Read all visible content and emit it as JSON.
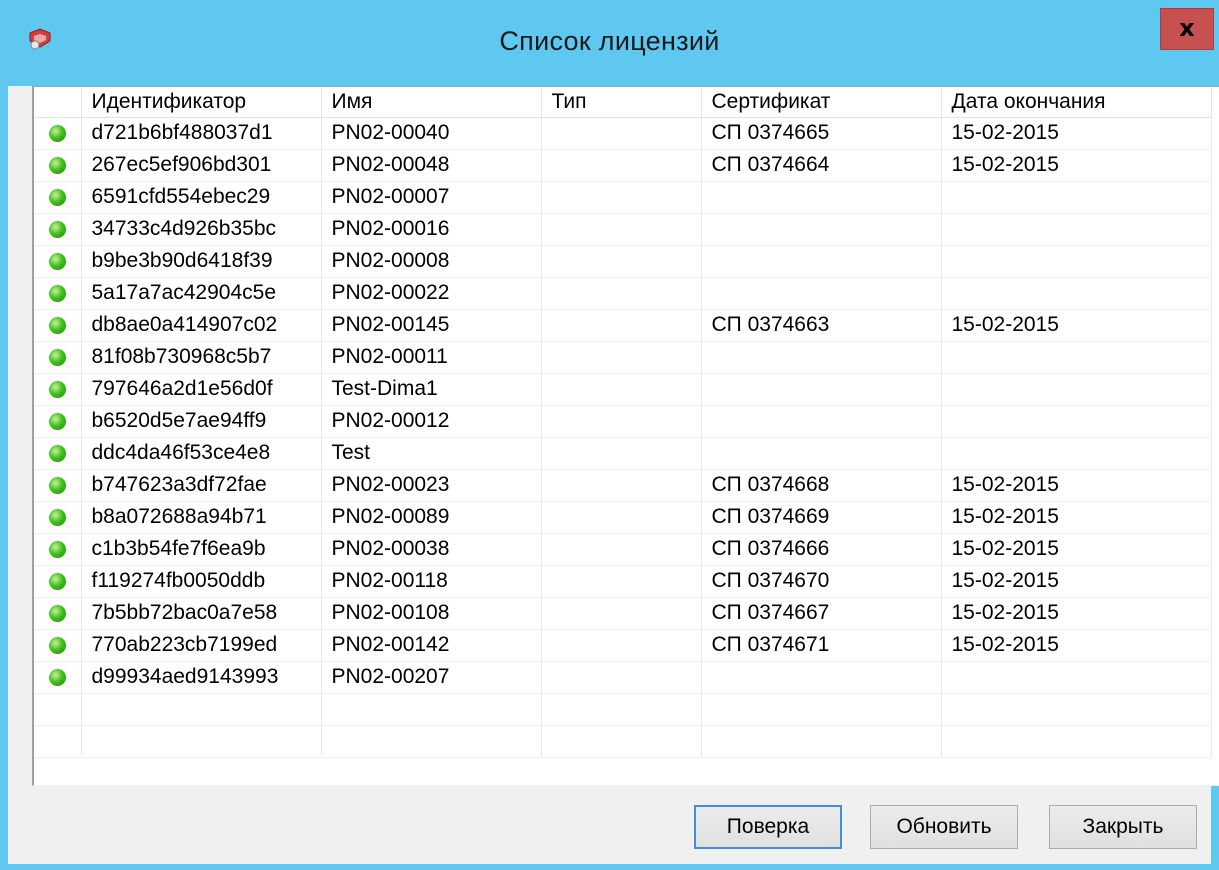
{
  "window": {
    "title": "Список лицензий",
    "close_label": "x",
    "app_icon": "license-app-icon",
    "accent_color": "#5ec8f0"
  },
  "table": {
    "columns": [
      "",
      "Идентификатор",
      "Имя",
      "Тип",
      "Сертификат",
      "Дата окончания"
    ],
    "rows": [
      {
        "status": "active",
        "id": "d721b6bf488037d1",
        "name": "PN02-00040",
        "type": "",
        "cert": "СП 0374665",
        "date": "15-02-2015"
      },
      {
        "status": "active",
        "id": "267ec5ef906bd301",
        "name": "PN02-00048",
        "type": "",
        "cert": "СП 0374664",
        "date": "15-02-2015"
      },
      {
        "status": "active",
        "id": "6591cfd554ebec29",
        "name": "PN02-00007",
        "type": "",
        "cert": "",
        "date": ""
      },
      {
        "status": "active",
        "id": "34733c4d926b35bc",
        "name": "PN02-00016",
        "type": "",
        "cert": "",
        "date": ""
      },
      {
        "status": "active",
        "id": "b9be3b90d6418f39",
        "name": "PN02-00008",
        "type": "",
        "cert": "",
        "date": ""
      },
      {
        "status": "active",
        "id": "5a17a7ac42904c5e",
        "name": "PN02-00022",
        "type": "",
        "cert": "",
        "date": ""
      },
      {
        "status": "active",
        "id": "db8ae0a414907c02",
        "name": "PN02-00145",
        "type": "",
        "cert": "СП 0374663",
        "date": "15-02-2015"
      },
      {
        "status": "active",
        "id": "81f08b730968c5b7",
        "name": "PN02-00011",
        "type": "",
        "cert": "",
        "date": ""
      },
      {
        "status": "active",
        "id": "797646a2d1e56d0f",
        "name": "Test-Dima1",
        "type": "",
        "cert": "",
        "date": ""
      },
      {
        "status": "active",
        "id": "b6520d5e7ae94ff9",
        "name": "PN02-00012",
        "type": "",
        "cert": "",
        "date": ""
      },
      {
        "status": "active",
        "id": "ddc4da46f53ce4e8",
        "name": "Test",
        "type": "",
        "cert": "",
        "date": ""
      },
      {
        "status": "active",
        "id": "b747623a3df72fae",
        "name": "PN02-00023",
        "type": "",
        "cert": "СП 0374668",
        "date": "15-02-2015"
      },
      {
        "status": "active",
        "id": "b8a072688a94b71",
        "name": "PN02-00089",
        "type": "",
        "cert": "СП 0374669",
        "date": "15-02-2015"
      },
      {
        "status": "active",
        "id": "c1b3b54fe7f6ea9b",
        "name": "PN02-00038",
        "type": "",
        "cert": "СП 0374666",
        "date": "15-02-2015"
      },
      {
        "status": "active",
        "id": "f119274fb0050ddb",
        "name": "PN02-00118",
        "type": "",
        "cert": "СП 0374670",
        "date": "15-02-2015"
      },
      {
        "status": "active",
        "id": "7b5bb72bac0a7e58",
        "name": "PN02-00108",
        "type": "",
        "cert": "СП 0374667",
        "date": "15-02-2015"
      },
      {
        "status": "active",
        "id": "770ab223cb7199ed",
        "name": "PN02-00142",
        "type": "",
        "cert": "СП 0374671",
        "date": "15-02-2015"
      },
      {
        "status": "active",
        "id": "d99934aed9143993",
        "name": "PN02-00207",
        "type": "",
        "cert": "",
        "date": ""
      }
    ],
    "empty_rows": 2
  },
  "buttons": {
    "verify": "Поверка",
    "refresh": "Обновить",
    "close": "Закрыть"
  }
}
